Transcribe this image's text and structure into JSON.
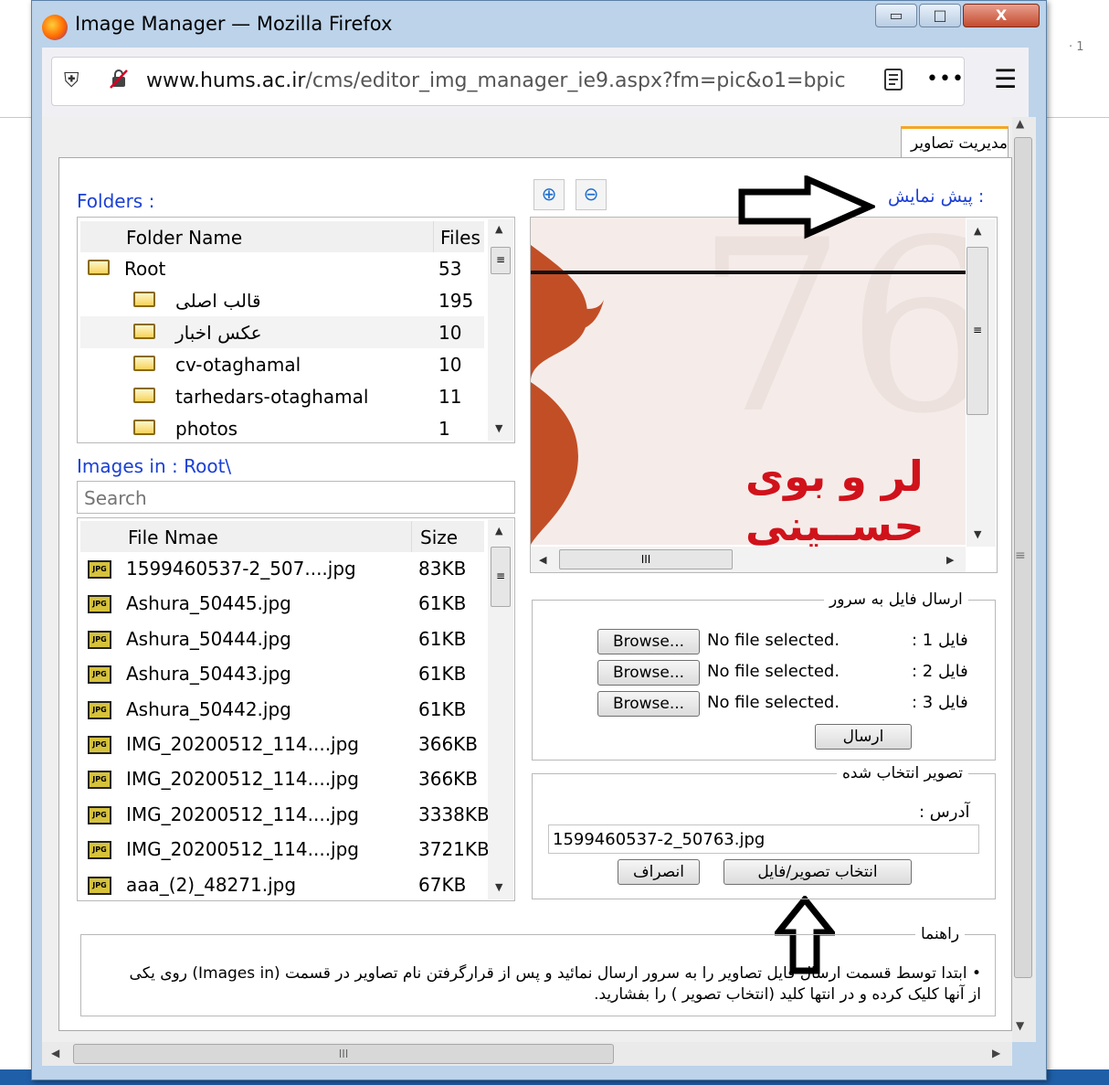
{
  "window": {
    "title": "Image Manager — Mozilla Firefox",
    "min": "▭",
    "max": "□",
    "close": "X"
  },
  "urlbar": {
    "domain": "www.hums.ac.ir",
    "path": "/cms/editor_img_manager_ie9.aspx?fm=pic&o1=bpic"
  },
  "background": {
    "right_text": "· 1"
  },
  "tab": {
    "label": "مدیریت تصاویر"
  },
  "folders": {
    "label": "Folders :",
    "headers": {
      "name": "Folder Name",
      "files": "Files"
    },
    "rows": [
      {
        "name": "Root",
        "files": "53"
      },
      {
        "name": "قالب اصلی",
        "files": "195"
      },
      {
        "name": "عکس اخبار",
        "files": "10"
      },
      {
        "name": "cv-otaghamal",
        "files": "10"
      },
      {
        "name": "tarhedars-otaghamal",
        "files": "11"
      },
      {
        "name": "photos",
        "files": "1"
      }
    ]
  },
  "images": {
    "label": "Images in : Root\\",
    "search_placeholder": "Search",
    "headers": {
      "name": "File Nmae",
      "size": "Size"
    },
    "rows": [
      {
        "name": "1599460537-2_507....jpg",
        "size": "83KB"
      },
      {
        "name": "Ashura_50445.jpg",
        "size": "61KB"
      },
      {
        "name": "Ashura_50444.jpg",
        "size": "61KB"
      },
      {
        "name": "Ashura_50443.jpg",
        "size": "61KB"
      },
      {
        "name": "Ashura_50442.jpg",
        "size": "61KB"
      },
      {
        "name": "IMG_20200512_114....jpg",
        "size": "366KB"
      },
      {
        "name": "IMG_20200512_114....jpg",
        "size": "366KB"
      },
      {
        "name": "IMG_20200512_114....jpg",
        "size": "3338KB"
      },
      {
        "name": "IMG_20200512_114....jpg",
        "size": "3721KB"
      },
      {
        "name": "aaa_(2)_48271.jpg",
        "size": "67KB"
      }
    ]
  },
  "preview": {
    "label": "پیش نمایش :",
    "image_text": "لر و بوی حســینی",
    "scroll_grip": "III"
  },
  "upload": {
    "legend": "ارسال فایل به سرور",
    "browse_label": "Browse...",
    "no_file": "No file selected.",
    "fields": [
      "فایل 1 :",
      "فایل 2 :",
      "فایل 3 :"
    ],
    "send_label": "ارسال"
  },
  "selected": {
    "legend": "تصویر انتخاب شده",
    "address_label": "آدرس :",
    "address_value": "1599460537-2_50763.jpg",
    "select_label": "انتخاب تصویر/فایل",
    "cancel_label": "انصراف"
  },
  "help": {
    "legend": "راهنما",
    "text": "• ابتدا توسط قسمت ارسال فایل تصاویر را به سرور ارسال نمائید و پس از قرارگرفتن نام تصاویر در قسمت (Images in) روی یکی از آنها کلیک کرده و در انتها کلید (انتخاب تصویر ) را بفشارید."
  },
  "hscroll": {
    "grip": "III"
  },
  "colors": {
    "accent_blue": "#1a3fd6",
    "tab_accent": "#f5a623",
    "preview_text": "#d0121b"
  }
}
